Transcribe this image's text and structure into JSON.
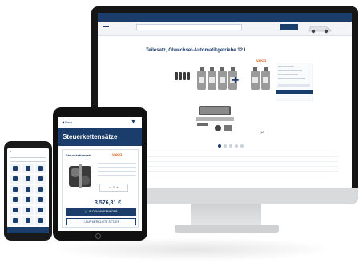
{
  "desktop": {
    "product_title": "Teilesatz, Ölwechsel-Automatikgetriebe 12 l",
    "brand": "VAICO"
  },
  "tablet": {
    "back_label": "Back",
    "banner_title": "Steuerkettensätze",
    "card_title": "Steuerkettensatz",
    "card_brand": "VAICO",
    "quantity": "1",
    "price": "3.576,81 €",
    "add_to_cart_label": "IN DEN WARENKORB",
    "watchlist_label": "AUF MERKLISTE SETZEN"
  },
  "colors": {
    "brand_blue": "#1b3d6b",
    "brand_orange": "#d44c00"
  }
}
